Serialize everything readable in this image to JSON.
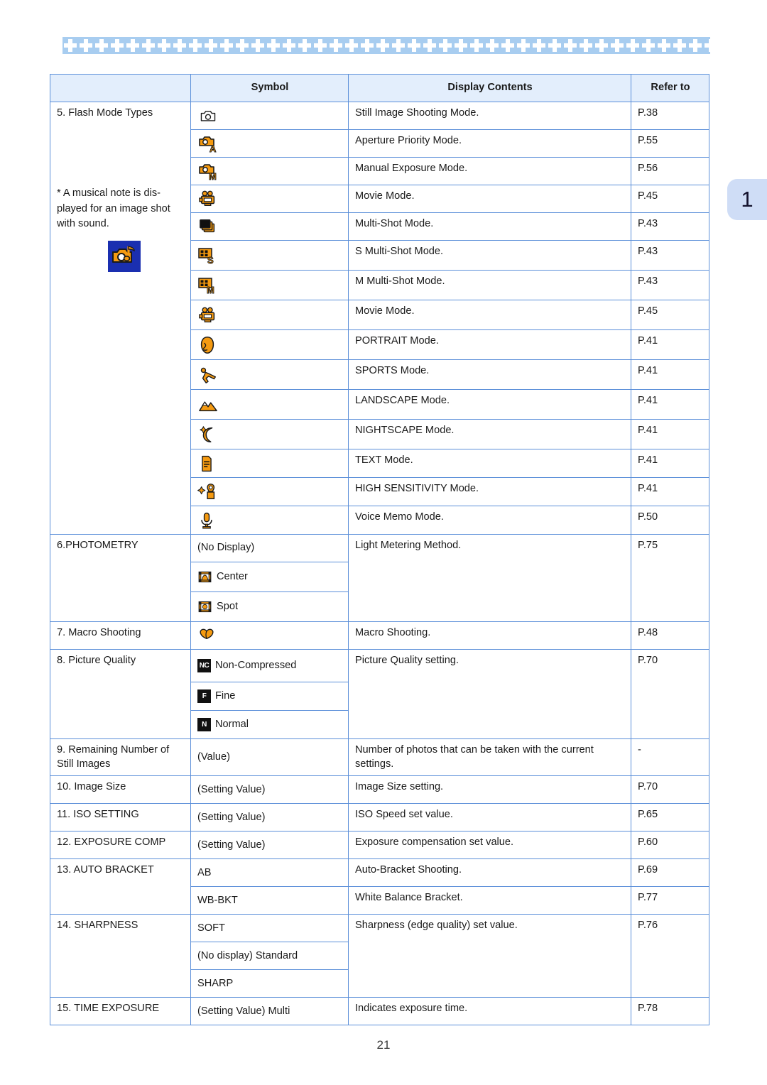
{
  "page": {
    "number": "21",
    "tab_label": "1",
    "decorative_band": "blue-floral-band"
  },
  "table": {
    "headers": [
      "",
      "Symbol",
      "Display Contents",
      "Refer to"
    ],
    "categories": [
      {
        "label": "5. Flash Mode Types",
        "note": "* A musical note is displayed for an image shot with sound.",
        "note_line1": "* A musical note is dis-",
        "note_line2": "played for an image shot",
        "note_line3": "with sound.",
        "badge_icon": "camera-with-music-note-icon"
      },
      {
        "label": "6.PHOTOMETRY"
      },
      {
        "label": "7. Macro Shooting"
      },
      {
        "label": "8. Picture Quality"
      },
      {
        "label": "9. Remaining Number of Still Images"
      },
      {
        "label": "10. Image Size"
      },
      {
        "label": "11. ISO SETTING"
      },
      {
        "label": "12. EXPOSURE COMP"
      },
      {
        "label": "13. AUTO BRACKET"
      },
      {
        "label": "14. SHARPNESS"
      },
      {
        "label": "15. TIME EXPOSURE"
      }
    ],
    "rows": [
      {
        "icon": "camera-outline-icon",
        "symbol_text": "",
        "contents": "Still Image Shooting Mode.",
        "refer": "P.38"
      },
      {
        "icon": "camera-aperture-a-icon",
        "symbol_text": "",
        "contents": "Aperture Priority Mode.",
        "refer": "P.55"
      },
      {
        "icon": "camera-manual-m-icon",
        "symbol_text": "",
        "contents": "Manual Exposure Mode.",
        "refer": "P.56"
      },
      {
        "icon": "movie-camera-icon",
        "symbol_text": "",
        "contents": "Movie Mode.",
        "refer": "P.45"
      },
      {
        "icon": "stacked-frames-icon",
        "symbol_text": "",
        "contents": "Multi-Shot Mode.",
        "refer": "P.43"
      },
      {
        "icon": "grid-s-icon",
        "symbol_text": "",
        "contents": "S Multi-Shot Mode.",
        "refer": "P.43"
      },
      {
        "icon": "grid-m-icon",
        "symbol_text": "",
        "contents": "M Multi-Shot Mode.",
        "refer": "P.43"
      },
      {
        "icon": "movie-camera-icon",
        "symbol_text": "",
        "contents": "Movie Mode.",
        "refer": "P.45"
      },
      {
        "icon": "portrait-face-icon",
        "symbol_text": "",
        "contents": "PORTRAIT Mode.",
        "refer": "P.41"
      },
      {
        "icon": "sports-runner-icon",
        "symbol_text": "",
        "contents": "SPORTS Mode.",
        "refer": "P.41"
      },
      {
        "icon": "landscape-mountains-icon",
        "symbol_text": "",
        "contents": "LANDSCAPE Mode.",
        "refer": "P.41"
      },
      {
        "icon": "nightscape-moon-icon",
        "symbol_text": "",
        "contents": "NIGHTSCAPE Mode.",
        "refer": "P.41"
      },
      {
        "icon": "text-document-icon",
        "symbol_text": "",
        "contents": "TEXT Mode.",
        "refer": "P.41"
      },
      {
        "icon": "high-sensitivity-icon",
        "symbol_text": "",
        "contents": "HIGH SENSITIVITY Mode.",
        "refer": "P.41"
      },
      {
        "icon": "microphone-icon",
        "symbol_text": "",
        "contents": "Voice Memo Mode.",
        "refer": "P.50"
      },
      {
        "icon": "",
        "symbol_text": "(No Display)",
        "contents": "Light Metering Method.",
        "refer": "P.75"
      },
      {
        "icon": "metering-center-icon",
        "symbol_text": "Center",
        "contents": "",
        "refer": ""
      },
      {
        "icon": "metering-spot-icon",
        "symbol_text": "Spot",
        "contents": "",
        "refer": ""
      },
      {
        "icon": "macro-flower-icon",
        "symbol_text": "",
        "contents": "Macro Shooting.",
        "refer": "P.48"
      },
      {
        "icon": "quality-nc-badge",
        "symbol_text": "Non-Compressed",
        "contents": "Picture Quality setting.",
        "refer": "P.70"
      },
      {
        "icon": "quality-f-badge",
        "symbol_text": "Fine",
        "contents": "",
        "refer": ""
      },
      {
        "icon": "quality-n-badge",
        "symbol_text": "Normal",
        "contents": "",
        "refer": ""
      },
      {
        "icon": "",
        "symbol_text": "(Value)",
        "contents": "Number of photos that can be taken with the current settings.",
        "refer": "-"
      },
      {
        "icon": "",
        "symbol_text": "(Setting Value)",
        "contents": "Image Size setting.",
        "refer": "P.70"
      },
      {
        "icon": "",
        "symbol_text": "(Setting Value)",
        "contents": "ISO Speed set value.",
        "refer": "P.65"
      },
      {
        "icon": "",
        "symbol_text": "(Setting Value)",
        "contents": "Exposure compensation set value.",
        "refer": "P.60"
      },
      {
        "icon": "",
        "symbol_text": "AB",
        "contents": "Auto-Bracket Shooting.",
        "refer": "P.69"
      },
      {
        "icon": "",
        "symbol_text": "WB-BKT",
        "contents": "White Balance Bracket.",
        "refer": "P.77"
      },
      {
        "icon": "",
        "symbol_text": "SOFT",
        "contents": "Sharpness (edge quality) set value.",
        "refer": "P.76"
      },
      {
        "icon": "",
        "symbol_text": "(No display) Standard",
        "contents": "",
        "refer": ""
      },
      {
        "icon": "",
        "symbol_text": "SHARP",
        "contents": "",
        "refer": ""
      },
      {
        "icon": "",
        "symbol_text": "(Setting Value) Multi",
        "contents": "Indicates exposure time.",
        "refer": "P.78"
      }
    ]
  },
  "colors": {
    "border_blue": "#5b8fd9",
    "header_fill": "#e3eefc",
    "band_blue": "#a8cdf0",
    "tab_blue": "#cfddf6",
    "icon_orange": "#f59a10",
    "badge_navy": "#1a2fb0"
  }
}
